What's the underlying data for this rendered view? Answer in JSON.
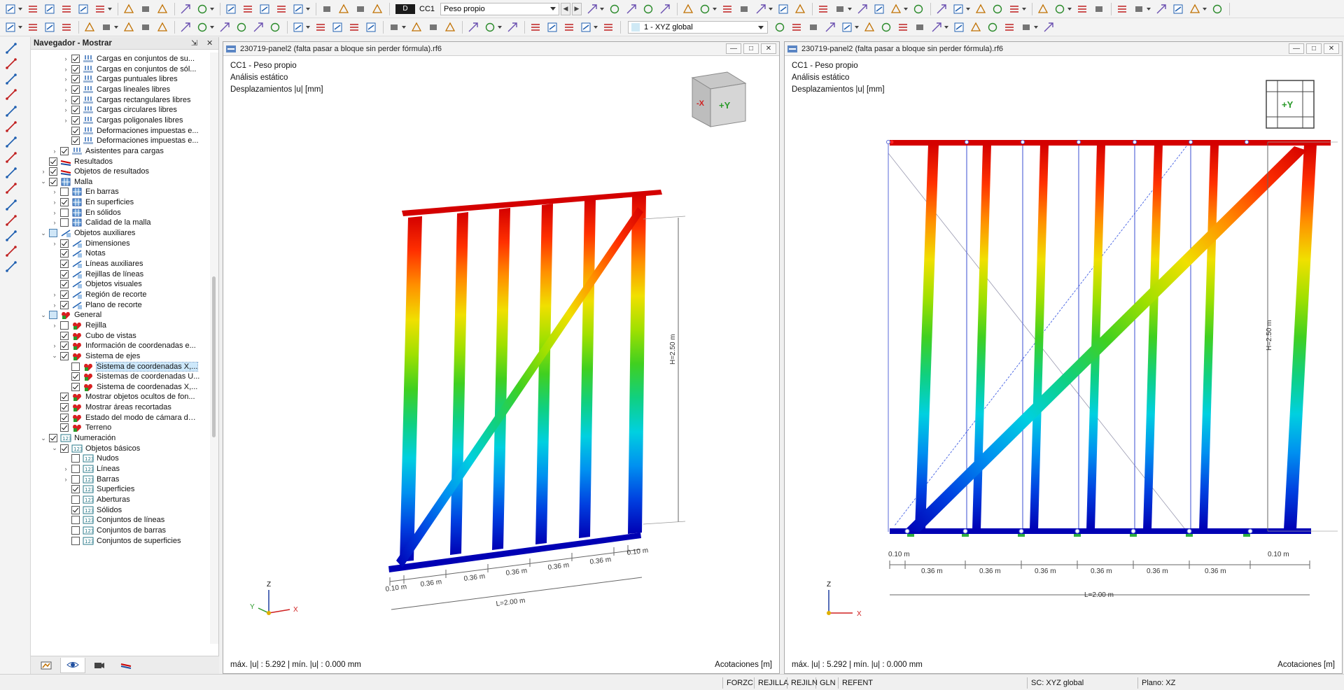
{
  "toolbar": {
    "load_case_type": "D",
    "load_case_code": "CC1",
    "load_case_name": "Peso propio",
    "coord_system": "1 - XYZ global"
  },
  "navigator": {
    "title": "Navegador - Mostrar",
    "pin_label": "⇲",
    "close_label": "✕",
    "items": [
      {
        "label": "Cargas en conjuntos de su...",
        "level": 3,
        "exp": ">",
        "cb": "on",
        "icon": "load"
      },
      {
        "label": "Cargas en conjuntos de sól...",
        "level": 3,
        "exp": ">",
        "cb": "on",
        "icon": "load"
      },
      {
        "label": "Cargas puntuales libres",
        "level": 3,
        "exp": ">",
        "cb": "on",
        "icon": "load"
      },
      {
        "label": "Cargas lineales libres",
        "level": 3,
        "exp": ">",
        "cb": "on",
        "icon": "load"
      },
      {
        "label": "Cargas rectangulares libres",
        "level": 3,
        "exp": ">",
        "cb": "on",
        "icon": "load"
      },
      {
        "label": "Cargas circulares libres",
        "level": 3,
        "exp": ">",
        "cb": "on",
        "icon": "load"
      },
      {
        "label": "Cargas poligonales libres",
        "level": 3,
        "exp": ">",
        "cb": "on",
        "icon": "load"
      },
      {
        "label": "Deformaciones impuestas e...",
        "level": 3,
        "exp": "",
        "cb": "on",
        "icon": "load"
      },
      {
        "label": "Deformaciones impuestas e...",
        "level": 3,
        "exp": "",
        "cb": "on",
        "icon": "load"
      },
      {
        "label": "Asistentes para cargas",
        "level": 2,
        "exp": ">",
        "cb": "on",
        "icon": "load"
      },
      {
        "label": "Resultados",
        "level": 1,
        "exp": "",
        "cb": "on",
        "icon": "res"
      },
      {
        "label": "Objetos de resultados",
        "level": 1,
        "exp": ">",
        "cb": "on",
        "icon": "res"
      },
      {
        "label": "Malla",
        "level": 1,
        "exp": "v",
        "cb": "on",
        "icon": "mesh"
      },
      {
        "label": "En barras",
        "level": 2,
        "exp": ">",
        "cb": "off",
        "icon": "mesh"
      },
      {
        "label": "En superficies",
        "level": 2,
        "exp": ">",
        "cb": "on",
        "icon": "mesh"
      },
      {
        "label": "En sólidos",
        "level": 2,
        "exp": ">",
        "cb": "off",
        "icon": "mesh"
      },
      {
        "label": "Calidad de la malla",
        "level": 2,
        "exp": ">",
        "cb": "off",
        "icon": "mesh"
      },
      {
        "label": "Objetos auxiliares",
        "level": 1,
        "exp": "v",
        "cb": "partial",
        "icon": "aux"
      },
      {
        "label": "Dimensiones",
        "level": 2,
        "exp": ">",
        "cb": "on",
        "icon": "aux"
      },
      {
        "label": "Notas",
        "level": 2,
        "exp": "",
        "cb": "on",
        "icon": "aux"
      },
      {
        "label": "Líneas auxiliares",
        "level": 2,
        "exp": "",
        "cb": "on",
        "icon": "aux"
      },
      {
        "label": "Rejillas de líneas",
        "level": 2,
        "exp": "",
        "cb": "on",
        "icon": "aux"
      },
      {
        "label": "Objetos visuales",
        "level": 2,
        "exp": "",
        "cb": "on",
        "icon": "aux"
      },
      {
        "label": "Región de recorte",
        "level": 2,
        "exp": ">",
        "cb": "on",
        "icon": "aux"
      },
      {
        "label": "Plano de recorte",
        "level": 2,
        "exp": ">",
        "cb": "on",
        "icon": "aux"
      },
      {
        "label": "General",
        "level": 1,
        "exp": "v",
        "cb": "partial",
        "icon": "gen"
      },
      {
        "label": "Rejilla",
        "level": 2,
        "exp": ">",
        "cb": "off",
        "icon": "gen"
      },
      {
        "label": "Cubo de vistas",
        "level": 2,
        "exp": "",
        "cb": "on",
        "icon": "gen"
      },
      {
        "label": "Información de coordenadas e...",
        "level": 2,
        "exp": ">",
        "cb": "on",
        "icon": "gen"
      },
      {
        "label": "Sistema de ejes",
        "level": 2,
        "exp": "v",
        "cb": "on",
        "icon": "gen"
      },
      {
        "label": "Sistema de coordenadas X,...",
        "level": 3,
        "exp": "",
        "cb": "off",
        "icon": "gen",
        "sel": true
      },
      {
        "label": "Sistemas de coordenadas U...",
        "level": 3,
        "exp": "",
        "cb": "on",
        "icon": "gen"
      },
      {
        "label": "Sistema de coordenadas X,...",
        "level": 3,
        "exp": "",
        "cb": "on",
        "icon": "gen"
      },
      {
        "label": "Mostrar objetos ocultos de fon...",
        "level": 2,
        "exp": "",
        "cb": "on",
        "icon": "gen"
      },
      {
        "label": "Mostrar áreas recortadas",
        "level": 2,
        "exp": "",
        "cb": "on",
        "icon": "gen"
      },
      {
        "label": "Estado del modo de cámara de ...",
        "level": 2,
        "exp": "",
        "cb": "on",
        "icon": "gen"
      },
      {
        "label": "Terreno",
        "level": 2,
        "exp": "",
        "cb": "on",
        "icon": "gen"
      },
      {
        "label": "Numeración",
        "level": 1,
        "exp": "v",
        "cb": "on",
        "icon": "num"
      },
      {
        "label": "Objetos básicos",
        "level": 2,
        "exp": "v",
        "cb": "on",
        "icon": "num"
      },
      {
        "label": "Nudos",
        "level": 3,
        "exp": "",
        "cb": "off",
        "icon": "num"
      },
      {
        "label": "Líneas",
        "level": 3,
        "exp": ">",
        "cb": "off",
        "icon": "num"
      },
      {
        "label": "Barras",
        "level": 3,
        "exp": ">",
        "cb": "off",
        "icon": "num"
      },
      {
        "label": "Superficies",
        "level": 3,
        "exp": "",
        "cb": "on",
        "icon": "num"
      },
      {
        "label": "Aberturas",
        "level": 3,
        "exp": "",
        "cb": "off",
        "icon": "num"
      },
      {
        "label": "Sólidos",
        "level": 3,
        "exp": "",
        "cb": "on",
        "icon": "num"
      },
      {
        "label": "Conjuntos de líneas",
        "level": 3,
        "exp": "",
        "cb": "off",
        "icon": "num"
      },
      {
        "label": "Conjuntos de barras",
        "level": 3,
        "exp": "",
        "cb": "off",
        "icon": "num"
      },
      {
        "label": "Conjuntos de superficies",
        "level": 3,
        "exp": "",
        "cb": "off",
        "icon": "num"
      }
    ]
  },
  "views": [
    {
      "title": "230719-panel2 (falta pasar a bloque sin perder fórmula).rf6",
      "info": [
        "CC1 - Peso propio",
        "Análisis estático",
        "Desplazamientos |u| [mm]"
      ],
      "footer_left": "máx. |u| : 5.292 | mín. |u| : 0.000 mm",
      "footer_right": "Acotaciones [m]",
      "cube_label_x": "-X",
      "cube_label_y": "+Y",
      "axis_z": "Z",
      "axis_x": "X",
      "axis_y": "Y",
      "dim_height": "H=2.50 m",
      "dim_length": "L=2.00 m",
      "dim_edge": "0.10 m",
      "dim_bay": "0.36 m"
    },
    {
      "title": "230719-panel2 (falta pasar a bloque sin perder fórmula).rf6",
      "info": [
        "CC1 - Peso propio",
        "Análisis estático",
        "Desplazamientos |u| [mm]"
      ],
      "footer_left": "máx. |u| : 5.292 | mín. |u| : 0.000 mm",
      "footer_right": "Acotaciones [m]",
      "cube_label_y": "+Y",
      "axis_z": "Z",
      "axis_x": "X",
      "dim_height": "H=2.50 m",
      "dim_length": "L=2.00 m",
      "dim_edge": "0.10 m",
      "dim_bay": "0.36 m"
    }
  ],
  "statusbar": {
    "items": [
      "FORZC",
      "REJILLA",
      "REJILN",
      "GLN",
      "REFENT"
    ],
    "cs": "SC: XYZ global",
    "plane": "Plano: XZ"
  },
  "colors": {
    "accent": "#1f6fd0",
    "max": "#d40000",
    "min": "#0000b4"
  }
}
